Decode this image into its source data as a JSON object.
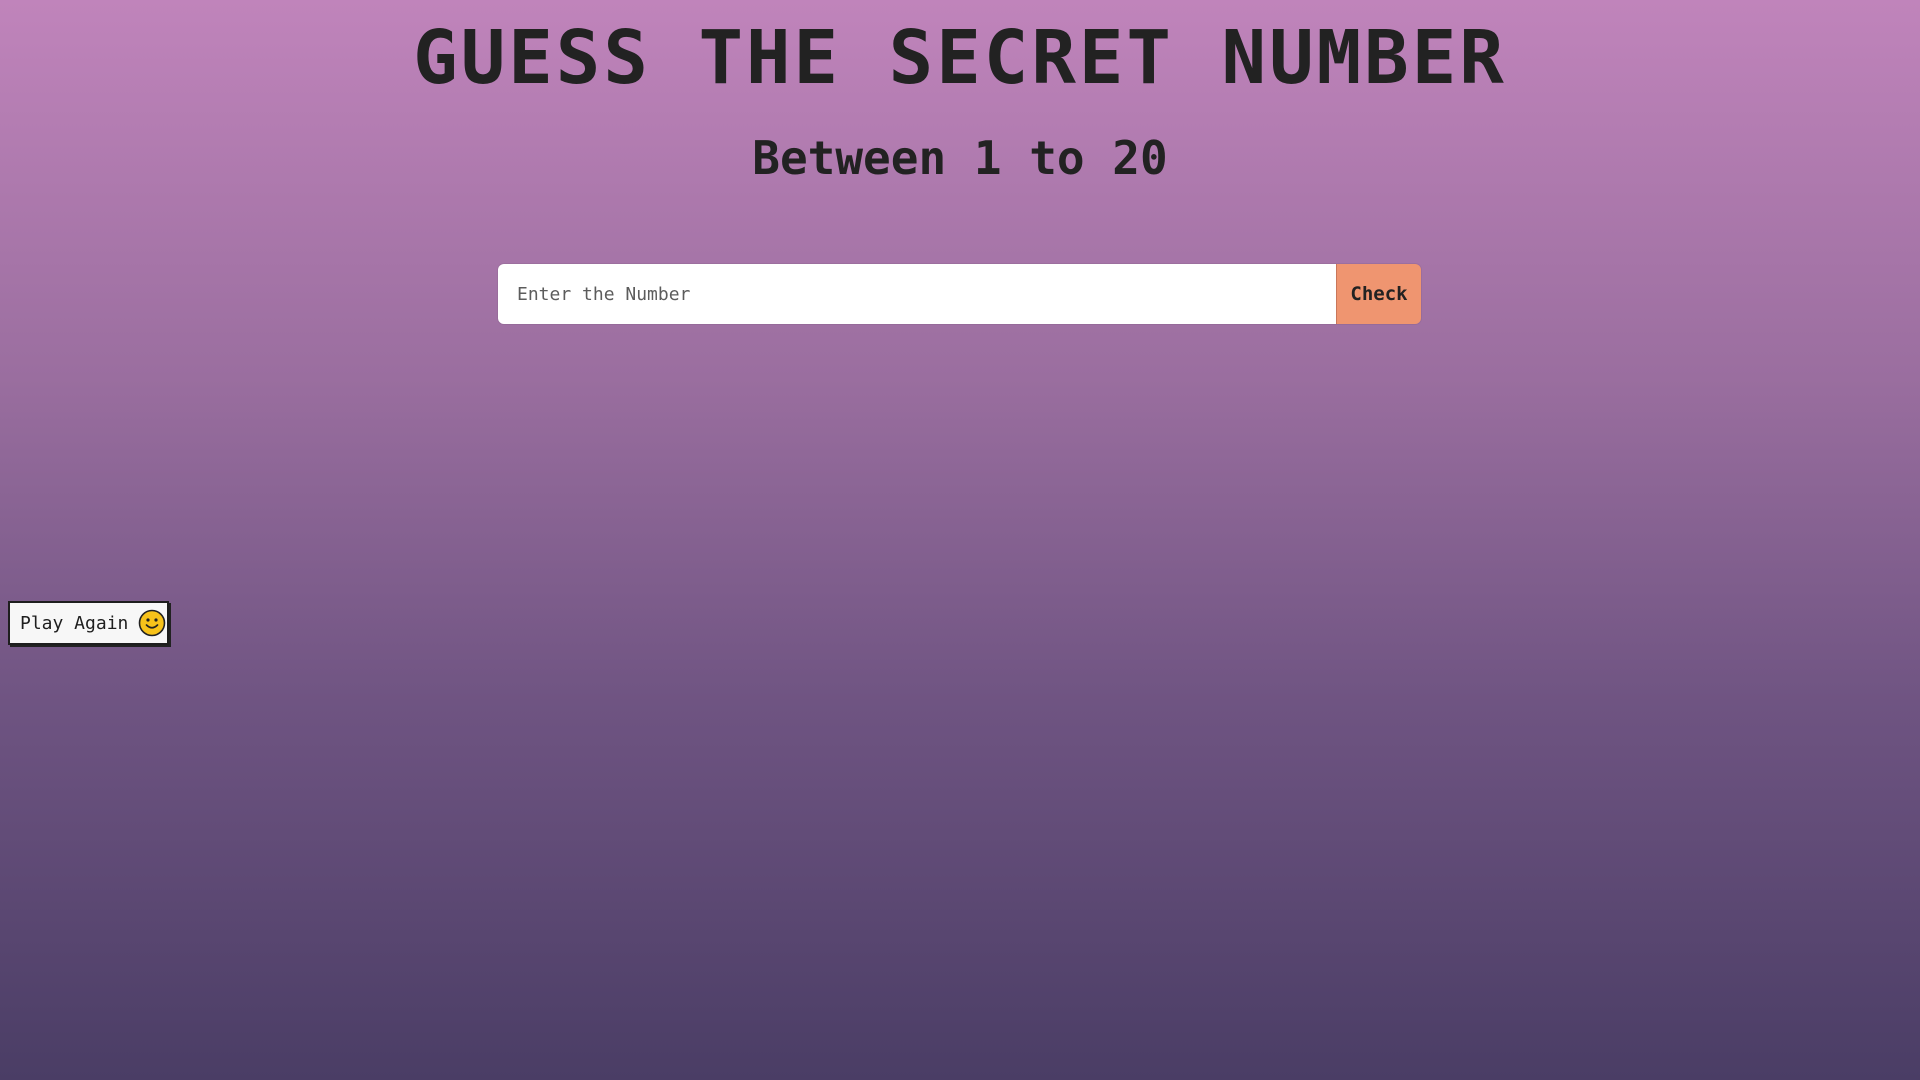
{
  "header": {
    "title": "GUESS THE SECRET NUMBER",
    "subtitle": "Between 1 to 20"
  },
  "form": {
    "input_value": "",
    "input_placeholder": "Enter the Number",
    "check_label": "Check"
  },
  "play_again": {
    "label": "Play Again",
    "icon": "smiley-face-icon"
  },
  "colors": {
    "check_button": "#ef9570",
    "background_top": "#c084bb",
    "background_bottom": "#4a3d65",
    "text": "#222222"
  }
}
